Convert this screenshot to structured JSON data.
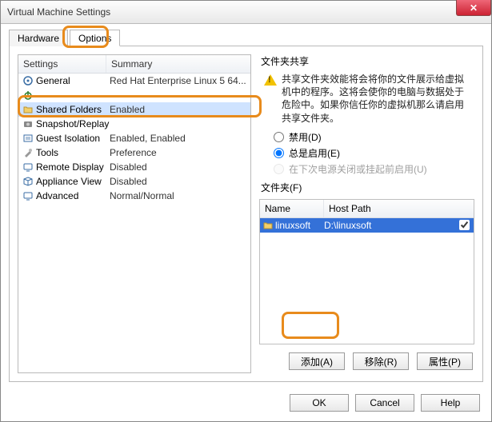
{
  "window": {
    "title": "Virtual Machine Settings"
  },
  "tabs": {
    "hardware": "Hardware",
    "options": "Options",
    "active": "options"
  },
  "settings_table": {
    "headers": {
      "col1": "Settings",
      "col2": "Summary"
    },
    "rows": [
      {
        "icon": "gear",
        "label": "General",
        "summary": "Red Hat Enterprise Linux 5 64..."
      },
      {
        "icon": "power",
        "label": "",
        "summary": ""
      },
      {
        "icon": "folder",
        "label": "Shared Folders",
        "summary": "Enabled",
        "selected": true
      },
      {
        "icon": "camera",
        "label": "Snapshot/Replay",
        "summary": ""
      },
      {
        "icon": "guest",
        "label": "Guest Isolation",
        "summary": "Enabled, Enabled"
      },
      {
        "icon": "tools",
        "label": "Tools",
        "summary": "Preference"
      },
      {
        "icon": "display",
        "label": "Remote Display",
        "summary": "Disabled"
      },
      {
        "icon": "cube",
        "label": "Appliance View",
        "summary": "Disabled"
      },
      {
        "icon": "display",
        "label": "Advanced",
        "summary": "Normal/Normal"
      }
    ]
  },
  "share": {
    "group_label": "文件夹共享",
    "description": "共享文件夹效能将会将你的文件展示给虚拟机中的程序。这将会使你的电脑与数据处于危险中。如果你信任你的虚拟机那么请启用共享文件夹。",
    "radio_disabled": "禁用(D)",
    "radio_always": "总是启用(E)",
    "radio_untilpwr": "在下次电源关闭或挂起前启用(U)",
    "selected": "always"
  },
  "folders": {
    "group_label": "文件夹(F)",
    "headers": {
      "name": "Name",
      "path": "Host Path"
    },
    "rows": [
      {
        "name": "linuxsoft",
        "path": "D:\\linuxsoft",
        "checked": true
      }
    ],
    "buttons": {
      "add": "添加(A)",
      "remove": "移除(R)",
      "props": "属性(P)"
    }
  },
  "dialog_buttons": {
    "ok": "OK",
    "cancel": "Cancel",
    "help": "Help"
  }
}
